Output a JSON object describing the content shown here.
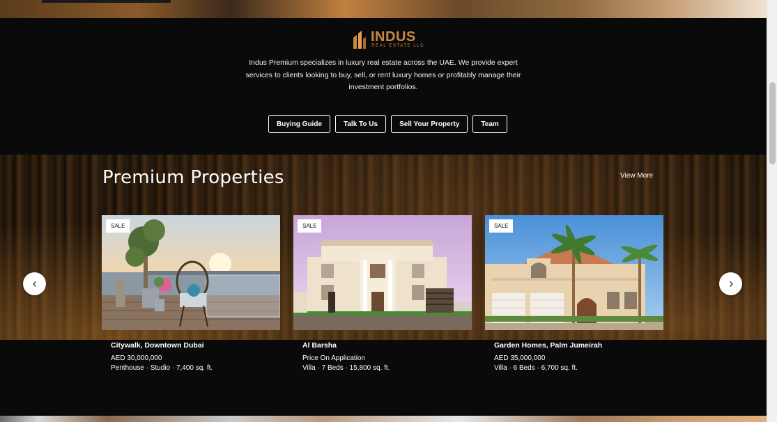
{
  "brand": {
    "name": "INDUS",
    "tagline": "REAL ESTATE LLC",
    "color": "#c8893f"
  },
  "intro_text": "Indus Premium specializes in luxury real estate across the UAE. We provide expert services to clients looking to buy, sell, or rent luxury homes or profitably manage their investment portfolios.",
  "buttons": [
    {
      "label": "Buying Guide"
    },
    {
      "label": "Talk To Us"
    },
    {
      "label": "Sell Your Property"
    },
    {
      "label": "Team"
    }
  ],
  "premium": {
    "title": "Premium Properties",
    "view_more": "View More",
    "cards": [
      {
        "badge": "SALE",
        "name": "Citywalk, Downtown Dubai",
        "price": "AED 30,000,000",
        "specs": "Penthouse · Studio · 7,400 sq. ft."
      },
      {
        "badge": "SALE",
        "name": "Al Barsha",
        "price": "Price On Application",
        "specs": "Villa · 7 Beds · 15,800 sq. ft."
      },
      {
        "badge": "SALE",
        "name": "Garden Homes, Palm Jumeirah",
        "price": "AED 35,000,000",
        "specs": "Villa · 6 Beds · 6,700 sq. ft."
      }
    ],
    "prev_icon": "chevron-left-icon",
    "next_icon": "chevron-right-icon"
  }
}
